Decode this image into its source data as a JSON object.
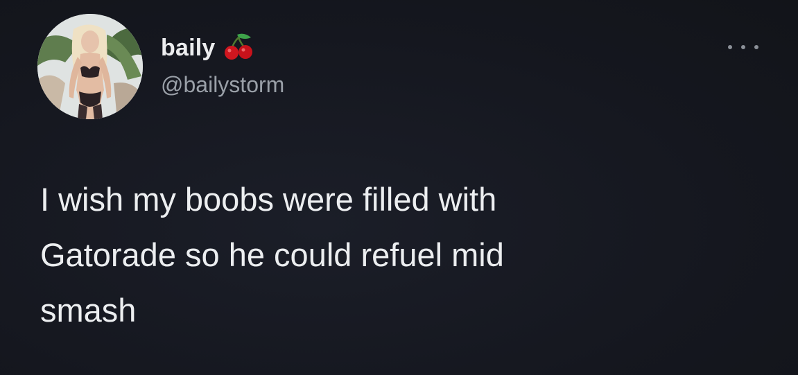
{
  "author": {
    "display_name": "baily",
    "name_emoji": "cherry-emoji",
    "handle": "@bailystorm"
  },
  "icons": {
    "more": "more-options-icon"
  },
  "tweet": {
    "lines": [
      "I wish my boobs were filled with",
      "Gatorade so he could refuel mid",
      "smash"
    ]
  },
  "colors": {
    "background": "#15171f",
    "text": "#eceef0",
    "secondary_text": "#9aa0a8"
  }
}
